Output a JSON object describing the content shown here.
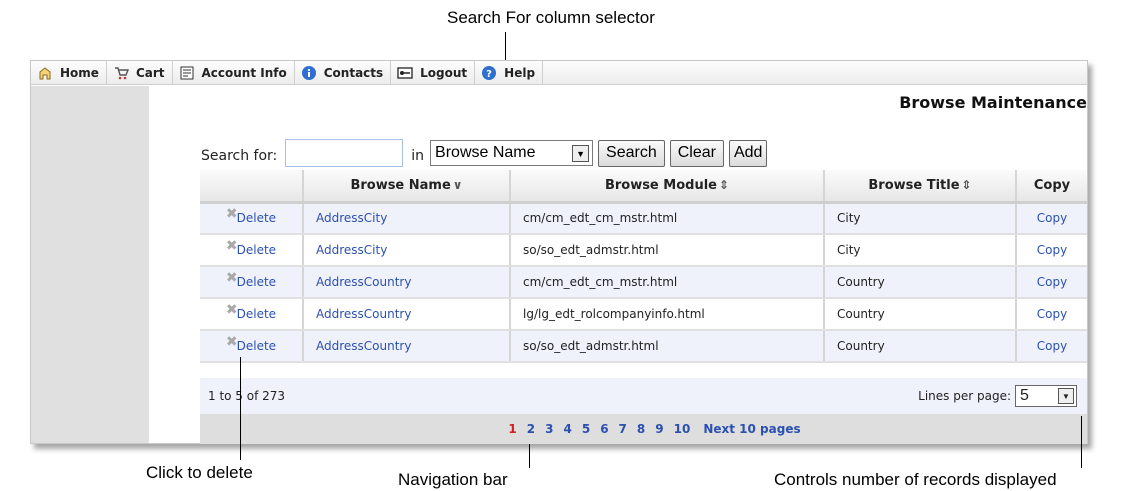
{
  "annotations": {
    "column_selector": "Search For column selector",
    "delete": "Click to delete",
    "navigation": "Navigation bar",
    "records": "Controls number of records displayed"
  },
  "nav": {
    "items": [
      {
        "label": "Home",
        "icon": "home-icon"
      },
      {
        "label": "Cart",
        "icon": "cart-icon"
      },
      {
        "label": "Account Info",
        "icon": "account-icon"
      },
      {
        "label": "Contacts",
        "icon": "info-icon"
      },
      {
        "label": "Logout",
        "icon": "logout-icon"
      },
      {
        "label": "Help",
        "icon": "help-icon"
      }
    ]
  },
  "page": {
    "title": "Browse Maintenance"
  },
  "search": {
    "label": "Search for:",
    "value": "",
    "in_label": "in",
    "column_selected": "Browse Name",
    "search_button": "Search",
    "clear_button": "Clear",
    "add_button": "Add"
  },
  "table": {
    "headers": {
      "name": "Browse Name",
      "module": "Browse Module",
      "title": "Browse Title",
      "copy": "Copy"
    },
    "rows": [
      {
        "delete": "Delete",
        "name": "AddressCity",
        "module": "cm/cm_edt_cm_mstr.html",
        "title": "City",
        "copy": "Copy"
      },
      {
        "delete": "Delete",
        "name": "AddressCity",
        "module": "so/so_edt_admstr.html",
        "title": "City",
        "copy": "Copy"
      },
      {
        "delete": "Delete",
        "name": "AddressCountry",
        "module": "cm/cm_edt_cm_mstr.html",
        "title": "Country",
        "copy": "Copy"
      },
      {
        "delete": "Delete",
        "name": "AddressCountry",
        "module": "lg/lg_edt_rolcompanyinfo.html",
        "title": "Country",
        "copy": "Copy"
      },
      {
        "delete": "Delete",
        "name": "AddressCountry",
        "module": "so/so_edt_admstr.html",
        "title": "Country",
        "copy": "Copy"
      }
    ]
  },
  "footer": {
    "record_info": "1 to 5 of 273",
    "lines_label": "Lines per page:",
    "lines_value": "5"
  },
  "pager": {
    "pages": [
      "1",
      "2",
      "3",
      "4",
      "5",
      "6",
      "7",
      "8",
      "9",
      "10"
    ],
    "current": "1",
    "next_label": "Next 10 pages"
  },
  "colors": {
    "link": "#2b50b0",
    "current_page": "#d02020",
    "odd_row": "#f0f2fb"
  }
}
